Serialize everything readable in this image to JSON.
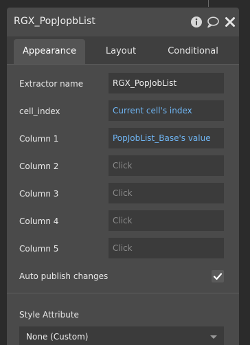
{
  "window": {
    "title": "RGX_PopJopbList"
  },
  "tabs": [
    {
      "label": "Appearance",
      "active": true
    },
    {
      "label": "Layout",
      "active": false
    },
    {
      "label": "Conditional",
      "active": false
    }
  ],
  "fields": [
    {
      "label": "Extractor name",
      "value": "RGX_PopJobList",
      "kind": "text"
    },
    {
      "label": "cell_index",
      "value": "Current cell's index",
      "kind": "dynamic"
    },
    {
      "label": "Column 1",
      "value": "PopJobList_Base's value",
      "kind": "dynamic"
    },
    {
      "label": "Column 2",
      "value": "Click",
      "kind": "placeholder"
    },
    {
      "label": "Column 3",
      "value": "Click",
      "kind": "placeholder"
    },
    {
      "label": "Column 4",
      "value": "Click",
      "kind": "placeholder"
    },
    {
      "label": "Column 5",
      "value": "Click",
      "kind": "placeholder"
    }
  ],
  "auto_publish": {
    "label": "Auto publish changes",
    "checked": true
  },
  "style": {
    "label": "Style Attribute",
    "value": "None (Custom)"
  },
  "colors": {
    "panel": "#4a4a4a",
    "dynamic_text": "#6fb5f3",
    "placeholder_text": "#8a8a8a"
  },
  "icons": [
    "info-icon",
    "comment-icon",
    "close-icon",
    "checkmark-icon",
    "chevron-down-icon"
  ]
}
